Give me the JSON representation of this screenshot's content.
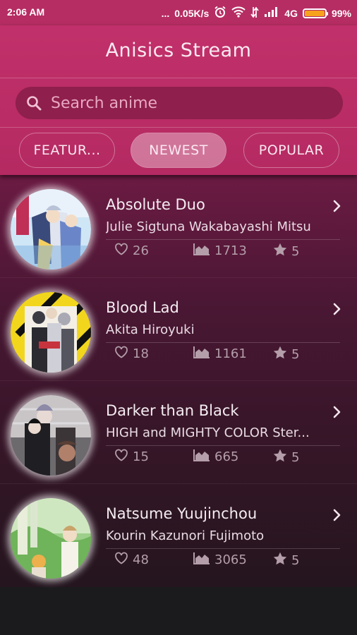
{
  "status_bar": {
    "time": "2:06 AM",
    "dots": "...",
    "speed": "0.05K/s",
    "network": "4G",
    "battery": "99%",
    "battery_level": 0.99
  },
  "app": {
    "title": "Anisics Stream"
  },
  "search": {
    "placeholder": "Search anime",
    "value": ""
  },
  "tabs": [
    {
      "label": "FEATUR...",
      "active": false
    },
    {
      "label": "NEWEST",
      "active": true
    },
    {
      "label": "POPULAR",
      "active": false
    }
  ],
  "anime": [
    {
      "title": "Absolute Duo",
      "subtitle": "Julie Sigtuna Wakabayashi Mitsu",
      "likes": "26",
      "views": "1713",
      "rating": "5"
    },
    {
      "title": "Blood Lad",
      "subtitle": "Akita Hiroyuki",
      "likes": "18",
      "views": "1161",
      "rating": "5"
    },
    {
      "title": "Darker than Black",
      "subtitle": "HIGH and MIGHTY COLOR Ster...",
      "likes": "15",
      "views": "665",
      "rating": "5"
    },
    {
      "title": "Natsume Yuujinchou",
      "subtitle": "Kourin Kazunori Fujimoto",
      "likes": "48",
      "views": "3065",
      "rating": "5"
    }
  ],
  "icons": {
    "search": "search-icon",
    "chevron": "chevron-right-icon",
    "like": "heart-icon",
    "views": "area-chart-icon",
    "rating": "star-icon"
  },
  "colors": {
    "primary": "#b62d63",
    "search_bg": "#8f1f4c",
    "list_top": "#6c1b43",
    "list_bottom": "#24151e"
  }
}
